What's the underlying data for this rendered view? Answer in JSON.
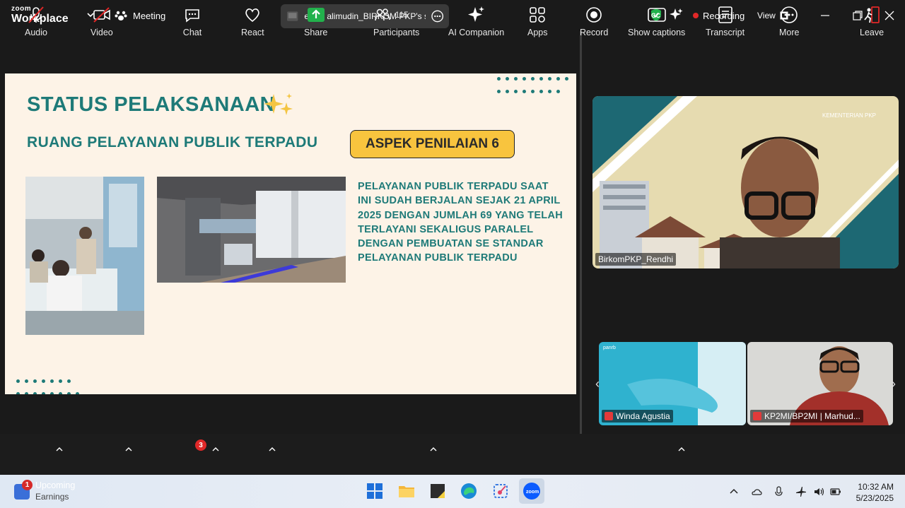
{
  "app": {
    "brand_top": "zoom",
    "brand_bottom": "Workplace",
    "meeting_label": "Meeting"
  },
  "share": {
    "label": "erwin alimudin_BIRKOM PKP's scre"
  },
  "status": {
    "recording": "Recording",
    "view": "View"
  },
  "slide": {
    "title": "STATUS PELAKSANAAN",
    "subtitle": "RUANG PELAYANAN PUBLIK TERPADU",
    "badge": "ASPEK PENILAIAN 6",
    "description": "PELAYANAN PUBLIK TERPADU SAAT INI SUDAH BERJALAN SEJAK 21 APRIL 2025 DENGAN JUMLAH 69 YANG TELAH TERLAYANI SEKALIGUS PARALEL DENGAN PEMBUATAN SE STANDAR PELAYANAN PUBLIK TERPADU"
  },
  "participants": {
    "main": {
      "name": "BirkomPKP_Rendhi"
    },
    "tile1": {
      "name": "Winda Agustia"
    },
    "tile2": {
      "name": "KP2MI/BP2MI | Marhud..."
    }
  },
  "toolbar": {
    "audio": "Audio",
    "video": "Video",
    "chat": "Chat",
    "chat_badge": "3",
    "react": "React",
    "share": "Share",
    "participants": "Participants",
    "participants_count": "115",
    "ai_companion": "AI Companion",
    "apps": "Apps",
    "record": "Record",
    "show_captions": "Show captions",
    "transcript": "Transcript",
    "more": "More",
    "leave": "Leave"
  },
  "taskbar": {
    "upcoming_title": "Upcoming",
    "upcoming_sub": "Earnings",
    "upcoming_badge": "1",
    "time": "10:32 AM",
    "date": "5/23/2025"
  },
  "colors": {
    "accent_teal": "#1e7a78",
    "badge_yellow": "#f8c43e",
    "recording_red": "#e02828",
    "share_green": "#22b14c",
    "leave_red": "#e02828"
  }
}
